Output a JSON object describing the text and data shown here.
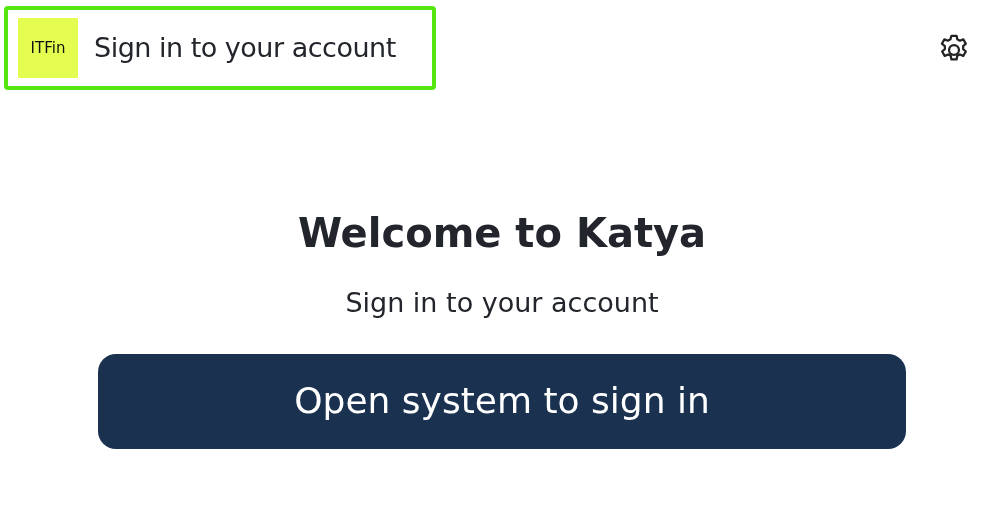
{
  "header": {
    "logo": "ITFin",
    "title": "Sign in to your account",
    "highlighted": true
  },
  "main": {
    "heading": "Welcome to Katya",
    "subtitle": "Sign in to your account",
    "button": "Open system to sign in"
  }
}
